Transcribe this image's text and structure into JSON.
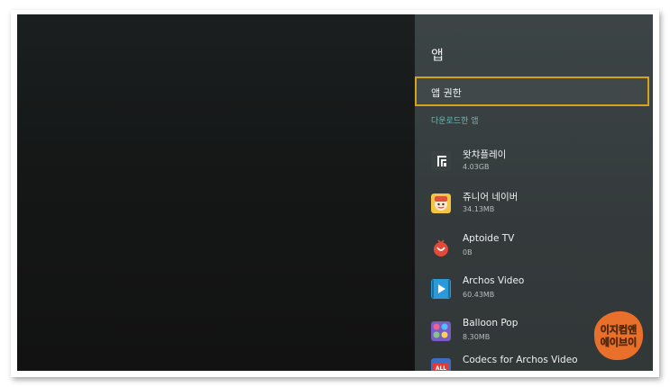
{
  "panel": {
    "title": "앱",
    "permissions_label": "앱 권한",
    "section_label": "다운로드한 앱"
  },
  "apps": [
    {
      "name": "왓챠플레이",
      "size": "4.03GB",
      "icon": "watcha-play-icon"
    },
    {
      "name": "쥬니어 네이버",
      "size": "34.13MB",
      "icon": "junior-naver-icon"
    },
    {
      "name": "Aptoide TV",
      "size": "0B",
      "icon": "aptoide-tv-icon"
    },
    {
      "name": "Archos Video",
      "size": "60.43MB",
      "icon": "archos-video-icon"
    },
    {
      "name": "Balloon Pop",
      "size": "8.30MB",
      "icon": "balloon-pop-icon"
    },
    {
      "name": "Codecs for Archos Video",
      "size": "",
      "icon": "archos-codecs-icon"
    }
  ],
  "watermark": {
    "line1": "이지컴앤",
    "line2": "에이브이"
  },
  "colors": {
    "focus_border": "#d6a21a",
    "section_accent": "#6fb7b3",
    "panel_bg": "#3a4243"
  }
}
